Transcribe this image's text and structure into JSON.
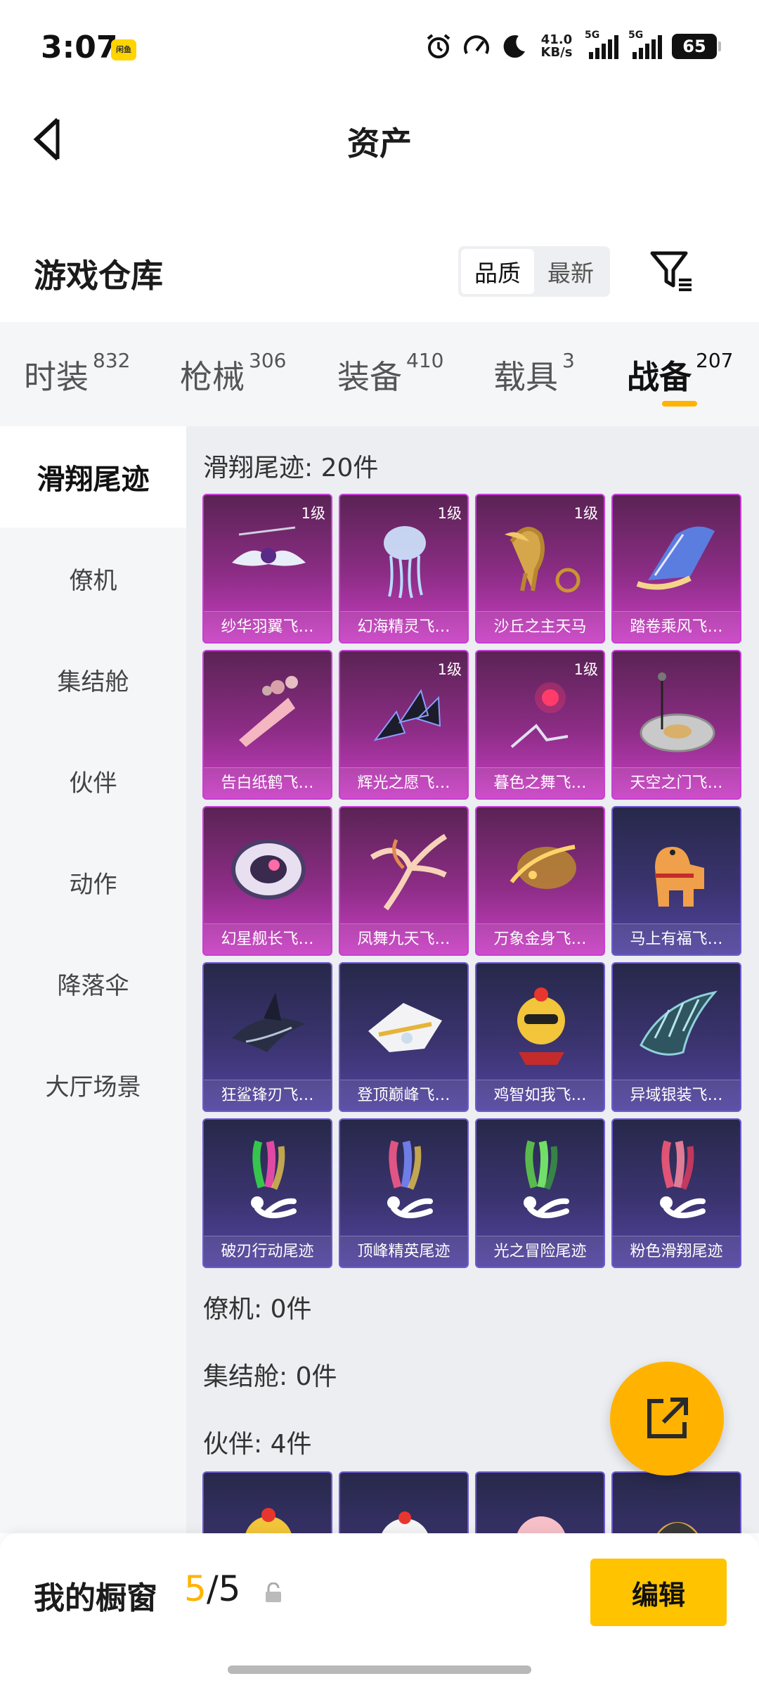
{
  "status": {
    "time": "3:07",
    "app_badge": "闲鱼",
    "net_speed": "41.0",
    "net_unit": "KB/s",
    "sim1": "5G",
    "sim2": "5G",
    "battery": "65"
  },
  "header": {
    "title": "资产"
  },
  "warehouse": {
    "title": "游戏仓库",
    "sort_options": [
      "品质",
      "最新"
    ],
    "sort_active": "品质"
  },
  "tabs": [
    {
      "label": "时装",
      "count": "832"
    },
    {
      "label": "枪械",
      "count": "306"
    },
    {
      "label": "装备",
      "count": "410"
    },
    {
      "label": "载具",
      "count": "3"
    },
    {
      "label": "战备",
      "count": "207",
      "active": true
    }
  ],
  "sidebar": [
    {
      "label": "滑翔尾迹",
      "active": true
    },
    {
      "label": "僚机"
    },
    {
      "label": "集结舱"
    },
    {
      "label": "伙伴"
    },
    {
      "label": "动作"
    },
    {
      "label": "降落伞"
    },
    {
      "label": "大厅场景"
    }
  ],
  "groups": {
    "glide_trail": {
      "heading": "滑翔尾迹: 20件",
      "items": [
        {
          "name": "纱华羽翼飞…",
          "level": "1级",
          "rarity": "purple",
          "icon": "winged-gem-icon"
        },
        {
          "name": "幻海精灵飞…",
          "level": "1级",
          "rarity": "purple",
          "icon": "jellyfish-icon"
        },
        {
          "name": "沙丘之主天马",
          "level": "1级",
          "rarity": "purple",
          "icon": "pegasus-chariot-icon"
        },
        {
          "name": "踏卷乘风飞…",
          "level": "",
          "rarity": "purple",
          "icon": "scroll-icon"
        },
        {
          "name": "告白纸鹤飞…",
          "level": "",
          "rarity": "purple",
          "icon": "paper-crane-icon"
        },
        {
          "name": "辉光之愿飞…",
          "level": "1级",
          "rarity": "purple",
          "icon": "crystal-wing-icon"
        },
        {
          "name": "暮色之舞飞…",
          "level": "1级",
          "rarity": "purple",
          "icon": "red-orb-icon"
        },
        {
          "name": "天空之门飞…",
          "level": "",
          "rarity": "purple",
          "icon": "sky-gate-icon"
        },
        {
          "name": "幻星舰长飞…",
          "level": "",
          "rarity": "purple",
          "icon": "star-ship-icon"
        },
        {
          "name": "凤舞九天飞…",
          "level": "",
          "rarity": "purple",
          "icon": "phoenix-icon"
        },
        {
          "name": "万象金身飞…",
          "level": "",
          "rarity": "purple",
          "icon": "golden-comet-icon"
        },
        {
          "name": "马上有福飞…",
          "level": "",
          "rarity": "blue",
          "icon": "toy-horse-icon"
        },
        {
          "name": "狂鲨锋刃飞…",
          "level": "",
          "rarity": "blue",
          "icon": "shark-icon"
        },
        {
          "name": "登顶巅峰飞…",
          "level": "",
          "rarity": "blue",
          "icon": "jet-glider-icon"
        },
        {
          "name": "鸡智如我飞…",
          "level": "",
          "rarity": "blue",
          "icon": "chicken-icon"
        },
        {
          "name": "异域银装飞…",
          "level": "",
          "rarity": "blue",
          "icon": "silver-wing-icon"
        },
        {
          "name": "破刃行动尾迹",
          "level": "",
          "rarity": "blue",
          "icon": "rainbow-trail-icon",
          "smoke": [
            "#36e04a",
            "#ff4fb0",
            "#ffd84a"
          ]
        },
        {
          "name": "顶峰精英尾迹",
          "level": "",
          "rarity": "blue",
          "icon": "rainbow-trail-icon",
          "smoke": [
            "#ff5c8a",
            "#7a8bff",
            "#ffd84a"
          ]
        },
        {
          "name": "光之冒险尾迹",
          "level": "",
          "rarity": "blue",
          "icon": "green-trail-icon",
          "smoke": [
            "#5fd24a",
            "#7cff6a",
            "#3aa83a"
          ]
        },
        {
          "name": "粉色滑翔尾迹",
          "level": "",
          "rarity": "blue",
          "icon": "pink-trail-icon",
          "smoke": [
            "#ff5a7a",
            "#ff8aa0",
            "#ff3d5e"
          ]
        }
      ]
    },
    "wingman": {
      "heading": "僚机: 0件"
    },
    "assembly_pod": {
      "heading": "集结舱: 0件"
    },
    "partner": {
      "heading": "伙伴: 4件",
      "items": [
        {
          "name": "",
          "rarity": "blue",
          "icon": "chicken-partner-icon"
        },
        {
          "name": "",
          "rarity": "blue",
          "icon": "white-chick-icon"
        },
        {
          "name": "",
          "rarity": "blue",
          "icon": "pink-pet-icon"
        },
        {
          "name": "",
          "rarity": "blue",
          "icon": "helmet-chick-icon"
        }
      ]
    }
  },
  "showcase": {
    "title": "我的橱窗",
    "count_current": "5",
    "count_sep": "/",
    "count_total": "5",
    "edit_label": "编辑"
  },
  "colors": {
    "accent": "#ffb300",
    "edit_button": "#ffc300",
    "purple_card": "#c93fc4",
    "blue_card": "#5243a0"
  }
}
